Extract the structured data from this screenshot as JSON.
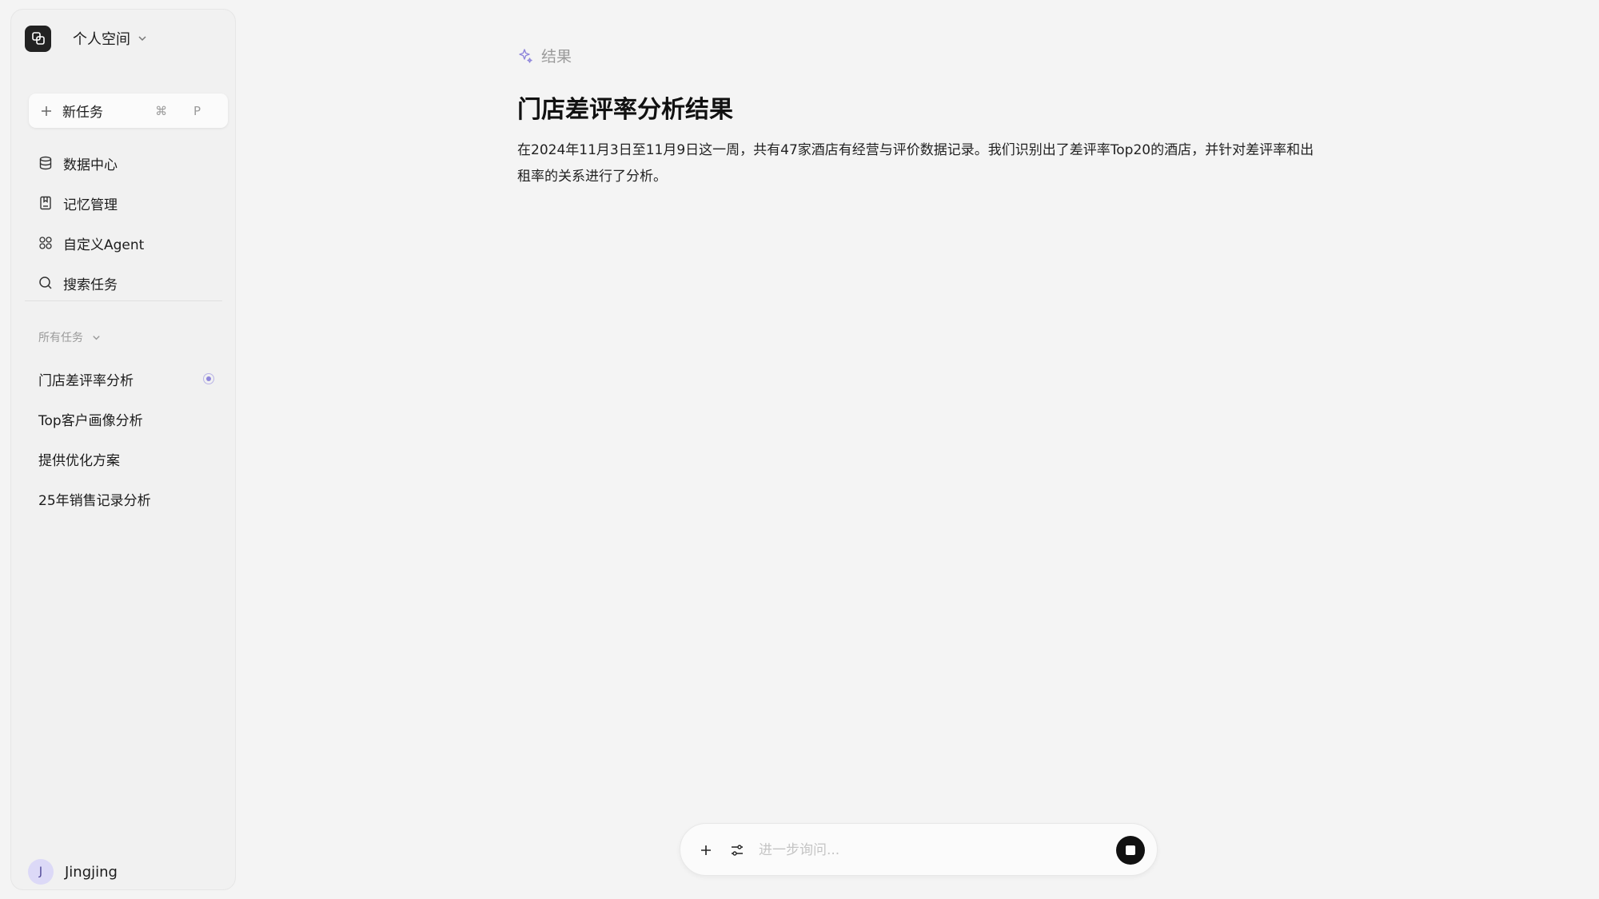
{
  "workspace": {
    "name": "个人空间",
    "logo_icon": "overlap-squares-icon"
  },
  "sidebar": {
    "new_task": {
      "label": "新任务",
      "shortcut": "⌘ P"
    },
    "nav": [
      {
        "label": "数据中心",
        "icon": "database-icon"
      },
      {
        "label": "记忆管理",
        "icon": "bookmark-icon"
      },
      {
        "label": "自定义Agent",
        "icon": "agent-icon"
      },
      {
        "label": "搜索任务",
        "icon": "search-icon"
      }
    ],
    "tasks_section_label": "所有任务",
    "tasks": [
      {
        "label": "门店差评率分析",
        "status": "running"
      },
      {
        "label": "Top客户画像分析"
      },
      {
        "label": "提供优化方案"
      },
      {
        "label": "25年销售记录分析"
      }
    ]
  },
  "user": {
    "avatar_initial": "J",
    "name": "Jingjing"
  },
  "main": {
    "result_label": "结果",
    "title": "门店差评率分析结果",
    "paragraph": "在2024年11月3日至11月9日这一周，共有47家酒店有经营与评价数据记录。我们识别出了差评率Top20的酒店，并针对差评率和出租率的关系进行了分析。"
  },
  "chat": {
    "placeholder": "进一步询问..."
  },
  "colors": {
    "accent": "#8f86db",
    "avatar_bg": "#dcd9f7",
    "background": "#f4f4f4"
  }
}
